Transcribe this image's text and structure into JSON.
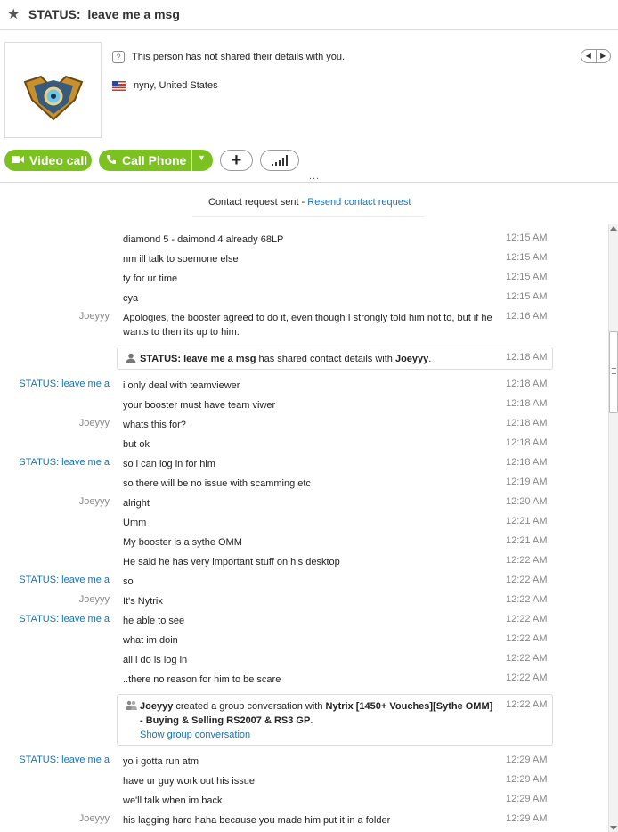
{
  "header": {
    "title": "STATUS:  leave me a msg",
    "details_note": "This person has not shared their details with you.",
    "location": "nyny, United States",
    "pager_prev": "◀",
    "pager_next": "▶"
  },
  "toolbar": {
    "video_call": "Video call",
    "call_phone": "Call Phone",
    "add": "+",
    "more": "..."
  },
  "contact_request": {
    "text": "Contact request sent - ",
    "link": "Resend contact request"
  },
  "messages": [
    {
      "sender": "",
      "text": "diamond 5 - daimond 4 already 68LP",
      "time": "12:15 AM"
    },
    {
      "sender": "",
      "text": "nm ill talk to soemone else",
      "time": "12:15 AM"
    },
    {
      "sender": "",
      "text": "ty for ur time",
      "time": "12:15 AM"
    },
    {
      "sender": "",
      "text": "cya",
      "time": "12:15 AM"
    },
    {
      "sender": "Joeyyy",
      "text": "Apologies, the booster agreed to do it, even though I strongly told him not to, but if he wants to then its up to him.",
      "time": "12:16 AM"
    },
    {
      "sender": "STATUS:  leave me a",
      "text": "i only deal with teamviewer",
      "time": "12:18 AM"
    },
    {
      "sender": "",
      "text": "your booster must have team viwer",
      "time": "12:18 AM"
    },
    {
      "sender": "Joeyyy",
      "text": "whats this for?",
      "time": "12:18 AM"
    },
    {
      "sender": "",
      "text": "but ok",
      "time": "12:18 AM"
    },
    {
      "sender": "STATUS:  leave me a",
      "text": "so i can log in for him",
      "time": "12:18 AM"
    },
    {
      "sender": "",
      "text": "so there will be no issue with scamming etc",
      "time": "12:19 AM"
    },
    {
      "sender": "Joeyyy",
      "text": "alright",
      "time": "12:20 AM"
    },
    {
      "sender": "",
      "text": "Umm",
      "time": "12:21 AM"
    },
    {
      "sender": "",
      "text": "My booster is a sythe OMM",
      "time": "12:21 AM"
    },
    {
      "sender": "",
      "text": "He said he has very important stuff on his desktop",
      "time": "12:22 AM"
    },
    {
      "sender": "STATUS:  leave me a",
      "text": "so",
      "time": "12:22 AM"
    },
    {
      "sender": "Joeyyy",
      "text": "It's Nytrix",
      "time": "12:22 AM"
    },
    {
      "sender": "STATUS:  leave me a",
      "text": "he able to see",
      "time": "12:22 AM"
    },
    {
      "sender": "",
      "text": "what im doin",
      "time": "12:22 AM"
    },
    {
      "sender": "",
      "text": "all i do is log in",
      "time": "12:22 AM"
    },
    {
      "sender": "",
      "text": "..there no reason for him to be scare",
      "time": "12:22 AM"
    },
    {
      "sender": "STATUS:  leave me a",
      "text": "yo i gotta run atm",
      "time": "12:29 AM"
    },
    {
      "sender": "",
      "text": "have ur guy work out his issue",
      "time": "12:29 AM"
    },
    {
      "sender": "",
      "text": "we'll talk when im back",
      "time": "12:29 AM"
    },
    {
      "sender": "Joeyyy",
      "text": "his lagging hard haha because you made him put it in a folder",
      "time": "12:29 AM"
    }
  ],
  "system_share": {
    "name": "STATUS:  leave me a msg",
    "middle": " has shared contact details with ",
    "target": "Joeyyy",
    "end": ".",
    "time": "12:18 AM"
  },
  "system_group": {
    "creator": "Joeyyy",
    "middle": " created a group conversation with ",
    "group": "Nytrix [1450+ Vouches][Sythe OMM] - Buying & Selling RS2007 & RS3 GP",
    "end": ".",
    "link": "Show group conversation",
    "time": "12:22 AM"
  },
  "colors": {
    "accent_green": "#7bc220",
    "link_blue": "#1a73b5",
    "muted_gray": "#888888"
  }
}
